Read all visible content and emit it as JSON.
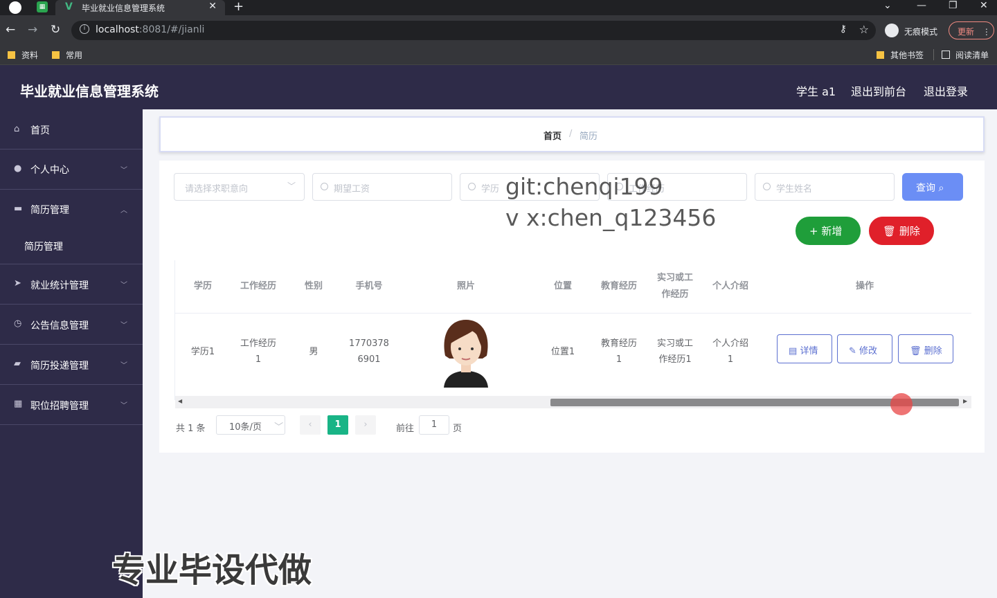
{
  "browser": {
    "tab_title": "毕业就业信息管理系统",
    "url_host": "localhost",
    "url_rest": ":8081/#/jianli",
    "incognito_label": "无痕模式",
    "update_label": "更新",
    "bookmarks": [
      "资料",
      "常用"
    ],
    "bookmarks_right": [
      "其他书签",
      "阅读清单"
    ]
  },
  "header": {
    "title": "毕业就业信息管理系统",
    "user": "学生 a1",
    "back_frontend": "退出到前台",
    "logout": "退出登录"
  },
  "sidebar": {
    "items": [
      {
        "label": "首页",
        "icon": "home-icon"
      },
      {
        "label": "个人中心",
        "icon": "user-icon"
      },
      {
        "label": "简历管理",
        "icon": "document-icon"
      },
      {
        "label": "就业统计管理",
        "icon": "send-icon"
      },
      {
        "label": "公告信息管理",
        "icon": "clock-icon"
      },
      {
        "label": "简历投递管理",
        "icon": "briefcase-icon"
      },
      {
        "label": "职位招聘管理",
        "icon": "grid-icon"
      }
    ],
    "sub_item": "简历管理"
  },
  "breadcrumb": {
    "home": "首页",
    "sep": "/",
    "current": "简历"
  },
  "search": {
    "direction_placeholder": "请选择求职意向",
    "salary_placeholder": "期望工资",
    "education_placeholder": "学历",
    "work_placeholder": "工作经历",
    "name_placeholder": "学生姓名",
    "query_label": "查询"
  },
  "actions": {
    "add_label": "新增",
    "delete_label": "删除"
  },
  "table": {
    "columns": [
      "学历",
      "工作经历",
      "性别",
      "手机号",
      "照片",
      "位置",
      "教育经历",
      "实习或工\n作经历",
      "个人介绍",
      "操作"
    ],
    "rows": [
      {
        "education": "学历1",
        "work": "工作经历\n1",
        "gender": "男",
        "phone": "1770378\n6901",
        "location": "位置1",
        "edu_history": "教育经历\n1",
        "internship": "实习或工\n作经历1",
        "intro": "个人介绍\n1"
      }
    ],
    "op_detail": "详情",
    "op_edit": "修改",
    "op_delete": "删除"
  },
  "pagination": {
    "total": "共 1 条",
    "page_size": "10条/页",
    "current_page": "1",
    "goto_label": "前往",
    "goto_value": "1",
    "page_suffix": "页"
  },
  "watermarks": {
    "line1": "git:chenqi199",
    "line2": "v x:chen_q123456",
    "bottom": "专业毕设代做"
  }
}
